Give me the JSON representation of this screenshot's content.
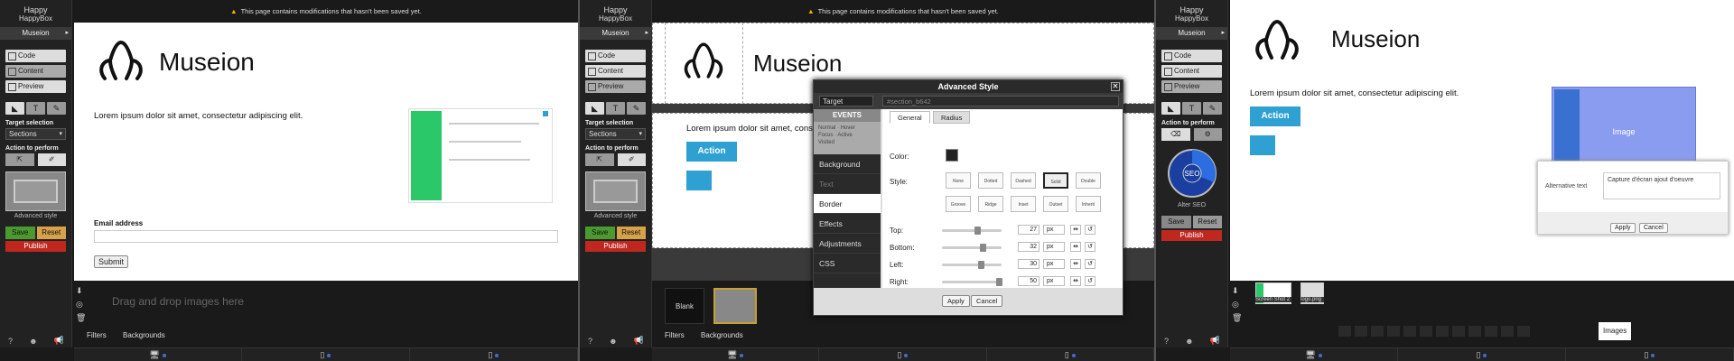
{
  "app": {
    "brand_top": "Happy",
    "brand": "HappyBox",
    "site": "Museion"
  },
  "warning": "This page contains modifications that hasn't been saved yet.",
  "sidebar": {
    "modes": [
      "Code",
      "Content",
      "Preview"
    ],
    "target_label": "Target selection",
    "target_value": "Sections",
    "action_label": "Action to perform",
    "advanced": "Advanced style",
    "alter_seo": "Alter SEO",
    "seo_badge": "SEO",
    "save": "Save",
    "reset": "Reset",
    "publish": "Publish"
  },
  "page": {
    "title": "Museion",
    "lorem": "Lorem ipsum dolor sit amet, consectetur adipiscing elit.",
    "email_label": "Email address",
    "submit": "Submit",
    "action": "Action"
  },
  "bottom": {
    "dropzone": "Drag and drop images here",
    "tabs": [
      "Filters",
      "Backgrounds"
    ],
    "blank": "Blank",
    "images_tab": "Images",
    "thumbs": [
      "Screen Shot 2",
      "logo.png"
    ]
  },
  "modal": {
    "title": "Advanced Style",
    "close": "✕",
    "target": "Target",
    "selector": "#section_b642",
    "events_head": "EVENTS",
    "events": [
      "Normal",
      "Hover",
      "Focus",
      "Active",
      "Visited"
    ],
    "items": [
      "Background",
      "Text",
      "Border",
      "Effects",
      "Adjustments",
      "CSS"
    ],
    "tabs": [
      "General",
      "Radius"
    ],
    "color_label": "Color:",
    "style_label": "Style:",
    "styles": [
      "None",
      "Dotted",
      "Dashed",
      "Solid",
      "Double",
      "Groove",
      "Ridge",
      "Inset",
      "Outset",
      "Inherit"
    ],
    "sides": [
      {
        "label": "Top:",
        "value": "27",
        "unit": "px"
      },
      {
        "label": "Bottom:",
        "value": "32",
        "unit": "px"
      },
      {
        "label": "Left:",
        "value": "30",
        "unit": "px"
      },
      {
        "label": "Right:",
        "value": "50",
        "unit": "px"
      }
    ],
    "apply": "Apply",
    "cancel": "Cancel"
  },
  "alt_popup": {
    "image_label": "Image",
    "label": "Alternative text",
    "value": "Capture d'écran ajout d'oeuvre",
    "apply": "Apply",
    "cancel": "Cancel"
  },
  "colors": {
    "accent": "#2ea0d2",
    "save": "#4a9a30",
    "reset": "#d6a24a",
    "publish": "#c0281f",
    "warning": "#f0b400"
  }
}
